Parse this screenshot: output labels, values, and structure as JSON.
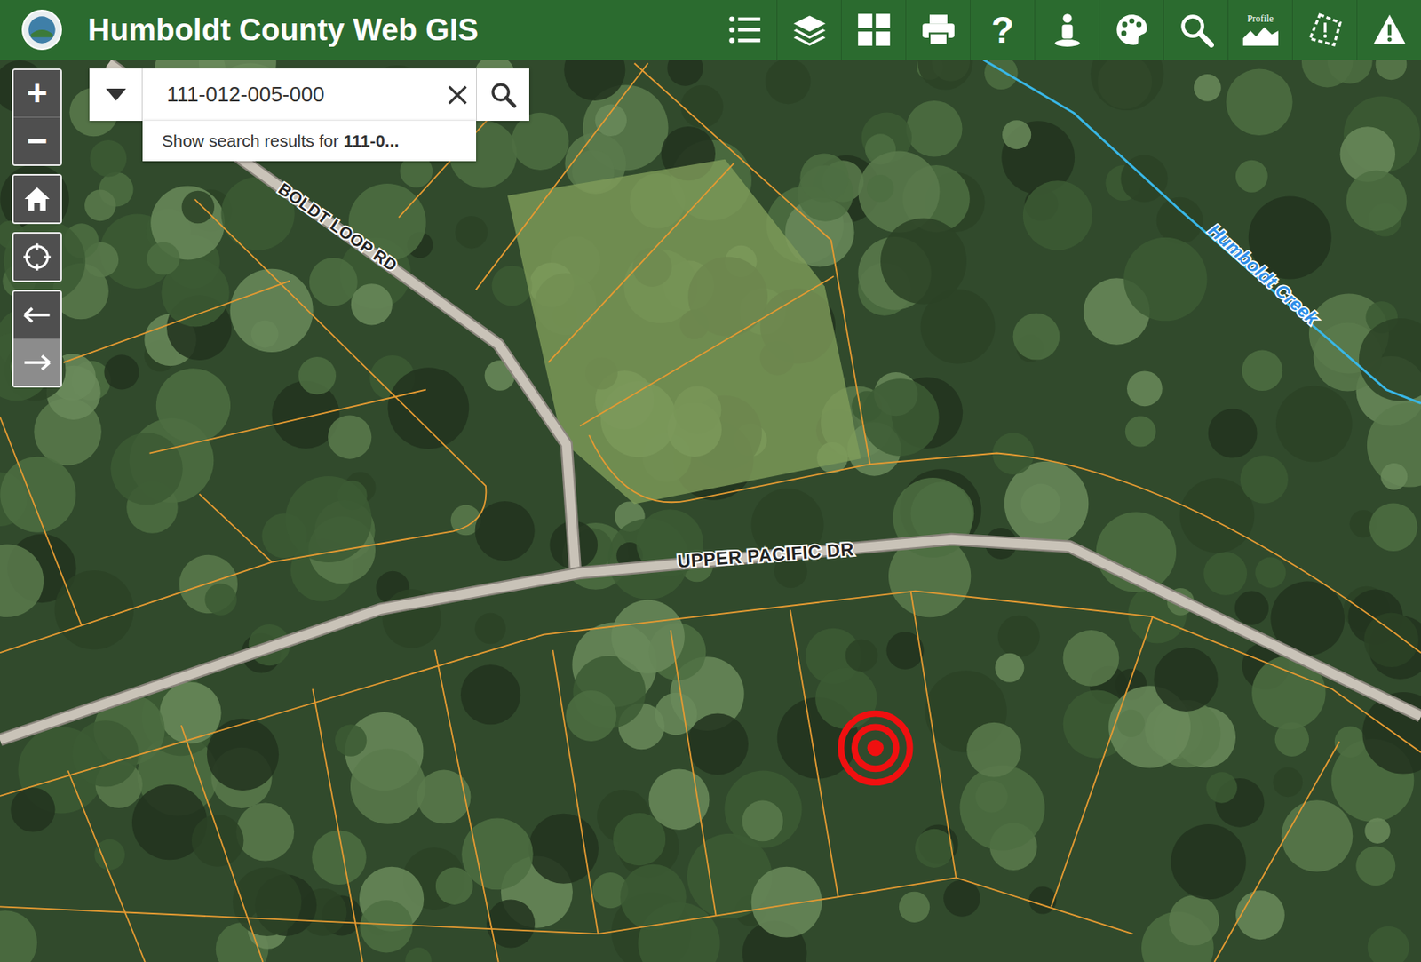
{
  "header": {
    "title": "Humboldt County Web GIS",
    "help_label": "?",
    "profile_label": "Profile"
  },
  "search": {
    "value": "111-012-005-000",
    "suggestion_prefix": "Show search results for",
    "suggestion_query": "111-0..."
  },
  "controls": {
    "zoom_in": "+",
    "zoom_out": "−",
    "back_enabled": true,
    "forward_enabled": false
  },
  "map": {
    "roads": [
      {
        "name": "BOLDT LOOP RD"
      },
      {
        "name": "UPPER PACIFIC DR"
      }
    ],
    "creek": {
      "name": "Humboldt Creek"
    }
  }
}
